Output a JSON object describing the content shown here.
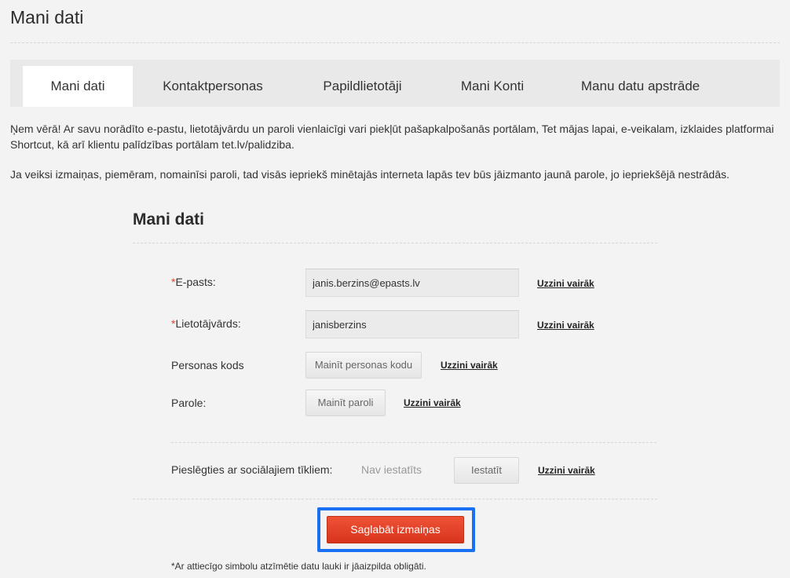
{
  "page": {
    "title": "Mani dati"
  },
  "tabs": [
    {
      "label": "Mani dati"
    },
    {
      "label": "Kontaktpersonas"
    },
    {
      "label": "Papildlietotāji"
    },
    {
      "label": "Mani Konti"
    },
    {
      "label": "Manu datu apstrāde"
    }
  ],
  "active_tab": "Mani dati",
  "notice": {
    "paragraph1": "Ņem vērā! Ar savu norādīto e-pastu, lietotājvārdu un paroli vienlaicīgi vari piekļūt pašapkalpošanās portālam, Tet mājas lapai, e-veikalam, izklaides platformai Shortcut, kā arī klientu palīdzības portālam tet.lv/palidziba.",
    "paragraph2": "Ja veiksi izmaiņas, piemēram, nomainīsi paroli, tad visās iepriekš minētajās interneta lapās tev būs jāizmanto jaunā parole, jo iepriekšējā nestrādās."
  },
  "form": {
    "title": "Mani dati",
    "required_mark": "*",
    "email": {
      "label": "E-pasts:",
      "value": "janis.berzins@epasts.lv"
    },
    "username": {
      "label": "Lietotājvārds:",
      "value": "janisberzins"
    },
    "personal_code": {
      "label": "Personas kods",
      "button": "Mainīt personas kodu"
    },
    "password": {
      "label": "Parole:",
      "button": "Mainīt paroli"
    },
    "social": {
      "label": "Pieslēgties ar sociālajiem tīkliem:",
      "status": "Nav iestatīts",
      "button": "Iestatīt"
    },
    "learn_more": "Uzzini vairāk",
    "save_button": "Saglabāt izmaiņas",
    "footnote": "*Ar attiecīgo simbolu atzīmētie datu lauki ir jāaizpilda obligāti."
  },
  "colors": {
    "accent_red": "#e0442e",
    "highlight_blue": "#1a6ff2",
    "background": "#f3f3f3"
  }
}
